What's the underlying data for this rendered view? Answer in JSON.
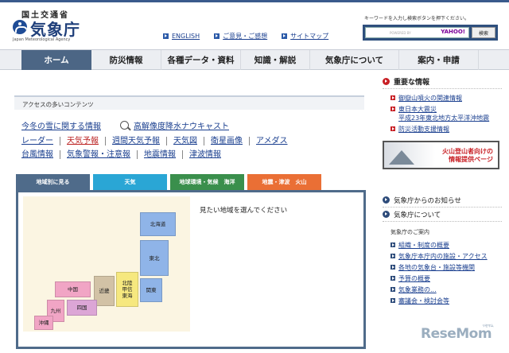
{
  "header": {
    "ministry": "国土交通省",
    "agency": "気象庁",
    "agency_en": "Japan Meteorological Agency",
    "links": [
      "ENGLISH",
      "ご意見・ご感想",
      "サイトマップ"
    ],
    "search_hint": "キーワードを入力し検索ボタンを押下ください。",
    "search_powered": "POWERED BY",
    "search_brand": "YAHOO!",
    "search_button": "検索"
  },
  "nav": {
    "items": [
      "ホーム",
      "防災情報",
      "各種データ・資料",
      "知識・解説",
      "気象庁について",
      "案内・申請"
    ]
  },
  "access": {
    "title": "アクセスの多いコンテンツ",
    "row1": [
      "今冬の雪に関する情報",
      "高解像度降水ナウキャスト"
    ],
    "row2": [
      "レーダー",
      "天気予報",
      "週間天気予報",
      "天気図",
      "衛星画像",
      "アメダス"
    ],
    "row3": [
      "台風情報",
      "気象警報・注意報",
      "地震情報",
      "津波情報"
    ]
  },
  "tabs": [
    "地域別に見る",
    "天気",
    "地球環境・気候　海洋",
    "地震・津波　火山"
  ],
  "map": {
    "prompt": "見たい地域を選んでください",
    "regions": [
      "北海道",
      "東北",
      "関東",
      "北陸\n甲信\n東海",
      "近畿",
      "中国",
      "四国",
      "九州",
      "沖縄"
    ]
  },
  "right": {
    "important_title": "重要な情報",
    "important_items": [
      "御嶽山噴火の関連情報",
      "東日本大震災\n平成23年東北地方太平洋沖地震",
      "防災活動支援情報"
    ],
    "banner_text": "火山登山者向けの\n情報提供ページ",
    "notice_title": "気象庁からのお知らせ",
    "about_title": "気象庁について",
    "about_subtitle": "気象庁のご案内",
    "about_items": [
      "組織・制度の概要",
      "気象庁本庁内の施設・アクセス",
      "各地の気象台・施設等機関",
      "予算の概要",
      "気象業務の...",
      "審議会・検討会等"
    ]
  },
  "watermark": "ReseMom",
  "watermark_small": "リセマム"
}
